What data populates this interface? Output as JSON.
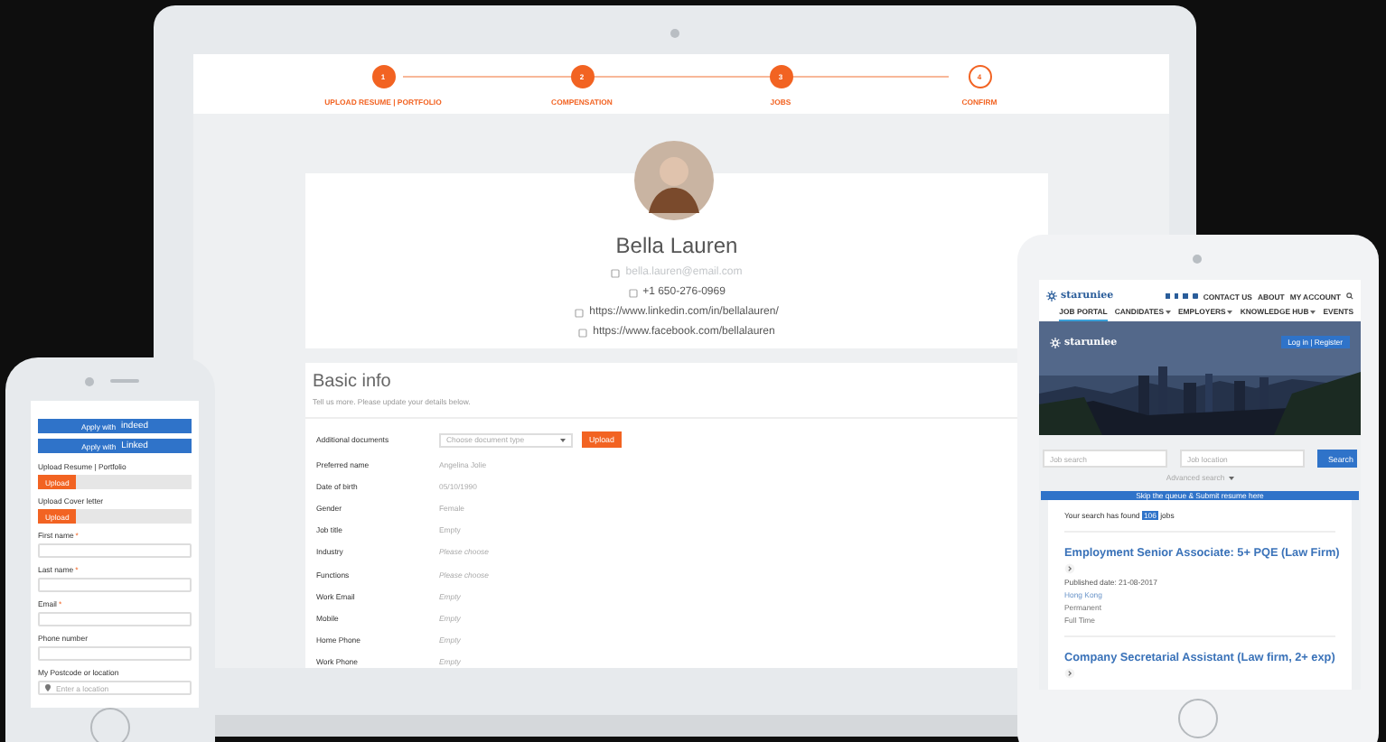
{
  "laptop": {
    "steps": [
      {
        "number": "1",
        "label": "UPLOAD RESUME | PORTFOLIO",
        "done": true
      },
      {
        "number": "2",
        "label": "COMPENSATION",
        "done": true
      },
      {
        "number": "3",
        "label": "JOBS",
        "done": true
      },
      {
        "number": "4",
        "label": "CONFIRM",
        "done": false
      }
    ],
    "profile": {
      "name": "Bella  Lauren",
      "email": "bella.lauren@email.com",
      "phone": "+1 650-276-0969",
      "links": [
        "https://www.linkedin.com/in/bellalauren/",
        "https://www.facebook.com/bellalauren"
      ]
    },
    "basic_info": {
      "title": "Basic info",
      "subtitle": "Tell us more. Please update your details below.",
      "documents": {
        "label": "Additional documents",
        "placeholder": "Choose document type",
        "button": "Upload"
      },
      "rows": [
        {
          "label": "Preferred name",
          "value": "Angelina Jolie",
          "empty": false
        },
        {
          "label": "Date of birth",
          "value": "05/10/1990",
          "empty": false
        },
        {
          "label": "Gender",
          "value": "Female",
          "empty": false
        },
        {
          "label": "Job title",
          "value": "Empty",
          "empty": false
        },
        {
          "label": "Industry",
          "value": "Please choose",
          "empty": true
        },
        {
          "label": "Functions",
          "value": "Please choose",
          "empty": true
        },
        {
          "label": "Work Email",
          "value": "Empty",
          "empty": true
        },
        {
          "label": "Mobile",
          "value": "Empty",
          "empty": true
        },
        {
          "label": "Home Phone",
          "value": "Empty",
          "empty": true
        },
        {
          "label": "Work Phone",
          "value": "Empty",
          "empty": true
        }
      ]
    }
  },
  "phone": {
    "apply_buttons": [
      {
        "prefix": "Apply with",
        "brand": "indeed"
      },
      {
        "prefix": "Apply with",
        "brand": "Linked"
      }
    ],
    "uploads": [
      {
        "label": "Upload Resume | Portfolio",
        "button": "Upload"
      },
      {
        "label": "Upload Cover letter",
        "button": "Upload"
      }
    ],
    "fields": [
      {
        "label": "First name",
        "required_mark": "*"
      },
      {
        "label": "Last name",
        "required_mark": "*"
      },
      {
        "label": "Email",
        "required_mark": "*"
      },
      {
        "label": "Phone number"
      }
    ],
    "location": {
      "label": "My Postcode or location",
      "placeholder": "Enter a location"
    }
  },
  "tablet": {
    "logo": "staruniee",
    "top_links": [
      "CONTACT US",
      "ABOUT",
      "MY ACCOUNT"
    ],
    "nav": [
      {
        "label": "JOB PORTAL",
        "selected": true,
        "menu": false
      },
      {
        "label": "CANDIDATES",
        "selected": false,
        "menu": true
      },
      {
        "label": "EMPLOYERS",
        "selected": false,
        "menu": true
      },
      {
        "label": "KNOWLEDGE HUB",
        "selected": false,
        "menu": true
      },
      {
        "label": "EVENTS",
        "selected": false,
        "menu": false
      }
    ],
    "hero": {
      "logo": "staruniee",
      "login": "Log in | Register"
    },
    "search": {
      "job_placeholder": "Job search",
      "location_placeholder": "Job location",
      "button": "Search",
      "advanced": "Advanced search"
    },
    "banner": "Skip the queue & Submit resume here",
    "results": {
      "prefix": "Your search has found",
      "count": "106",
      "suffix": "jobs"
    },
    "jobs": [
      {
        "title": "Employment Senior Associate: 5+ PQE (Law Firm)",
        "published": "Published date: 21-08-2017",
        "location": "Hong Kong",
        "type": "Permanent",
        "schedule": "Full Time"
      },
      {
        "title": "Company Secretarial Assistant (Law firm, 2+ exp)"
      }
    ]
  }
}
